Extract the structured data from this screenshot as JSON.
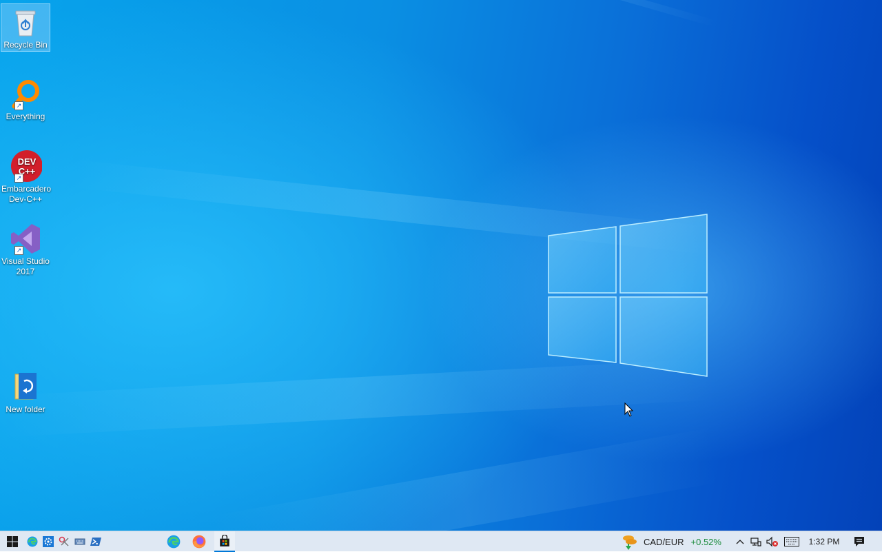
{
  "desktop": {
    "icons": [
      {
        "label": "Recycle Bin",
        "icon": "recycle-bin-icon"
      },
      {
        "label": "Everything",
        "icon": "everything-search-icon"
      },
      {
        "label": "Embarcadero Dev-C++",
        "icon": "devcpp-icon",
        "glyph": "DEV C++"
      },
      {
        "label": "Visual Studio 2017",
        "icon": "visual-studio-icon"
      },
      {
        "label": "New folder",
        "icon": "folder-icon"
      }
    ]
  },
  "taskbar": {
    "pinned": [
      {
        "name": "start-button",
        "icon": "windows-icon"
      },
      {
        "name": "edge-quicklaunch",
        "icon": "edge-icon"
      },
      {
        "name": "settings-quicklaunch",
        "icon": "gear-icon"
      },
      {
        "name": "snipping-quicklaunch",
        "icon": "scissors-icon"
      },
      {
        "name": "keyboard-quicklaunch",
        "icon": "keyboard-icon"
      },
      {
        "name": "powershell-quicklaunch",
        "icon": "terminal-icon"
      },
      {
        "name": "edge-taskbar",
        "icon": "edge-icon"
      },
      {
        "name": "firefox-taskbar",
        "icon": "firefox-icon"
      },
      {
        "name": "store-taskbar",
        "icon": "store-icon"
      }
    ],
    "widget": {
      "pair": "CAD/EUR",
      "change": "+0.52%",
      "change_color": "#1a8a3a"
    },
    "clock": "1:32 PM",
    "accent": "#0078d7"
  }
}
